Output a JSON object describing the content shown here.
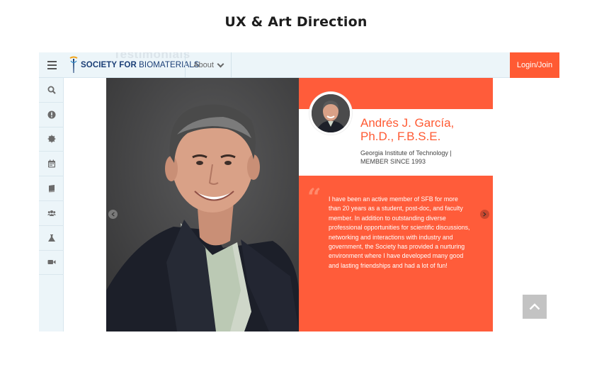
{
  "page": {
    "heading": "UX & Art  Direction"
  },
  "topbar": {
    "logo": {
      "brand": "SOCIETY FOR ",
      "brand_light": "BIOMATERIALS"
    },
    "ghost_heading": "Testimonials",
    "about_label": "About",
    "login_label": "Login/Join"
  },
  "sidebar": {
    "items": [
      {
        "icon": "search-icon"
      },
      {
        "icon": "alert-icon"
      },
      {
        "icon": "circle-icon"
      },
      {
        "icon": "calendar-icon"
      },
      {
        "icon": "book-icon"
      },
      {
        "icon": "users-icon"
      },
      {
        "icon": "flask-icon"
      },
      {
        "icon": "video-icon"
      }
    ]
  },
  "testimonial": {
    "name_line1": "Andrés J. García,",
    "name_line2": "Ph.D., F.B.S.E.",
    "affiliation_line1": "Georgia Institute of Technology |",
    "affiliation_line2": "MEMBER SINCE 1993",
    "quote_mark": "“",
    "quote": "I have been an active member of SFB for more than 20 years as a student, post-doc, and faculty member. In addition to outstanding diverse professional opportunities for scientific discussions, networking and interactions with industry and government, the Society has provided a nurturing environment where I have developed many good and lasting friendships and had a lot of fun!"
  },
  "colors": {
    "accent": "#ff5a33",
    "sidebar_bg": "#ecf5f9",
    "brand_text": "#1a3e76"
  }
}
